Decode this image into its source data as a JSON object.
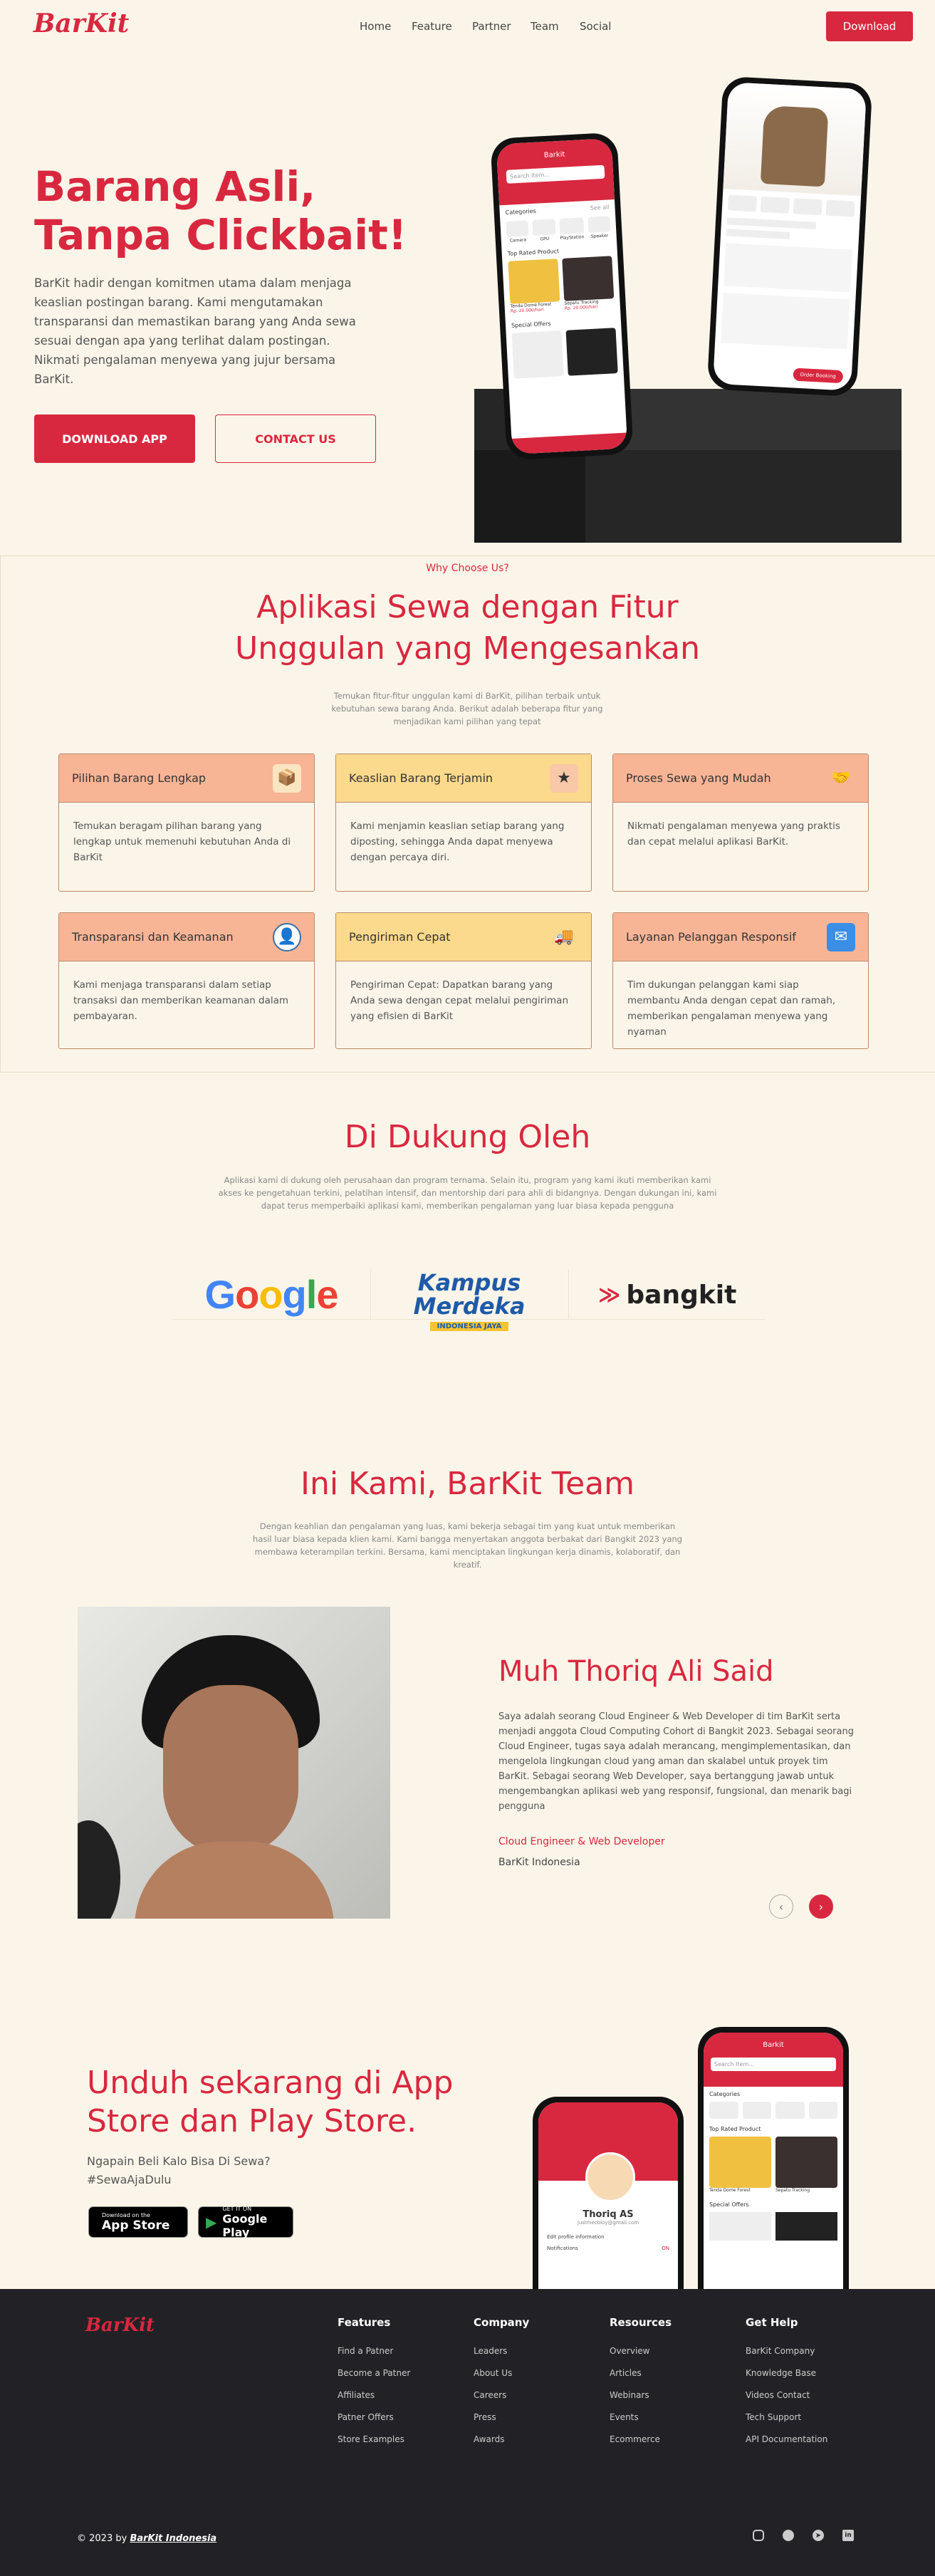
{
  "nav": {
    "logo": "BarKit",
    "links": [
      "Home",
      "Feature",
      "Partner",
      "Team",
      "Social"
    ],
    "download": "Download"
  },
  "hero": {
    "title_line1": "Barang Asli,",
    "title_line2": "Tanpa Clickbait!",
    "desc": "BarKit hadir dengan komitmen utama dalam menjaga keaslian postingan barang. Kami mengutamakan transparansi dan memastikan barang yang Anda sewa sesuai dengan apa yang terlihat dalam postingan. Nikmati pengalaman menyewa yang jujur bersama BarKit.",
    "download_app": "DOWNLOAD APP",
    "contact_us": "CONTACT US"
  },
  "phone_left": {
    "app_title": "Barkit",
    "search": "Search Item...",
    "categories": "Categories",
    "see_all": "See all",
    "cat_items": [
      "Camera",
      "GPU",
      "PlayStation",
      "Speaker"
    ],
    "top_rated": "Top Rated Product",
    "products": [
      {
        "name": "Tenda Dome Forest",
        "price": "Rp. 20.000/hari"
      },
      {
        "name": "Sepatu Tracking",
        "price": "Rp. 20.000/hari"
      }
    ],
    "special": "Special Offers"
  },
  "phone_right": {
    "order": "Order Booking"
  },
  "why": {
    "kicker": "Why Choose Us?",
    "title_line1": "Aplikasi Sewa dengan Fitur",
    "title_line2": "Unggulan yang Mengesankan",
    "desc": "Temukan fitur-fitur unggulan kami di BarKit, pilihan terbaik untuk kebutuhan sewa barang Anda. Berikut adalah beberapa fitur yang menjadikan kami pilihan yang tepat",
    "cards": [
      {
        "title": "Pilihan Barang Lengkap",
        "body": "Temukan beragam pilihan barang yang lengkap untuk memenuhi kebutuhan Anda di BarKit",
        "icon": "box-icon",
        "color": "#f8b596"
      },
      {
        "title": "Keaslian Barang Terjamin",
        "body": "Kami menjamin keaslian setiap barang yang diposting, sehingga Anda dapat menyewa dengan percaya diri.",
        "icon": "badge-icon",
        "color": "#fbd98d"
      },
      {
        "title": "Proses Sewa yang Mudah",
        "body": "Nikmati pengalaman menyewa yang praktis dan cepat melalui aplikasi BarKit.",
        "icon": "handshake-icon",
        "color": "#f8b596"
      },
      {
        "title": "Transparansi dan Keamanan",
        "body": "Kami menjaga transparansi dalam setiap transaksi dan memberikan keamanan dalam pembayaran.",
        "icon": "user-shield-icon",
        "color": "#f8b596"
      },
      {
        "title": "Pengiriman Cepat",
        "body": "Pengiriman Cepat: Dapatkan barang yang Anda sewa dengan cepat melalui pengiriman yang efisien di BarKit",
        "icon": "truck-icon",
        "color": "#fbd98d"
      },
      {
        "title": "Layanan Pelanggan Responsif",
        "body": "Tim dukungan pelanggan kami siap membantu Anda dengan cepat dan ramah, memberikan pengalaman menyewa yang nyaman",
        "icon": "support-icon",
        "color": "#f8b596"
      }
    ]
  },
  "support": {
    "title": "Di Dukung Oleh",
    "desc": "Aplikasi kami di dukung oleh perusahaan dan program ternama. Selain itu, program yang kami ikuti memberikan kami akses ke pengetahuan terkini, pelatihan intensif, dan mentorship dari para ahli di bidangnya. Dengan dukungan ini, kami dapat terus memperbaiki aplikasi kami, memberikan pengalaman yang luar biasa kepada pengguna",
    "google": "Google",
    "kampus1": "Kampus",
    "kampus2": "Merdeka",
    "kampus3": "INDONESIA JAYA",
    "bangkit": "bangkit"
  },
  "team": {
    "title": "Ini Kami, BarKit Team",
    "desc": "Dengan keahlian dan pengalaman yang luas, kami bekerja sebagai tim yang kuat untuk memberikan hasil luar biasa kepada klien kami. Kami bangga menyertakan anggota berbakat dari Bangkit 2023 yang membawa keterampilan terkini. Bersama, kami menciptakan lingkungan kerja dinamis, kolaboratif, dan kreatif.",
    "name": "Muh Thoriq Ali Said",
    "bio": "Saya adalah seorang Cloud Engineer & Web Developer di tim BarKit serta menjadi anggota Cloud Computing Cohort di Bangkit 2023. Sebagai seorang Cloud Engineer, tugas saya adalah merancang, mengimplementasikan, dan mengelola lingkungan cloud yang aman dan skalabel untuk proyek tim BarKit. Sebagai seorang Web Developer, saya bertanggung jawab untuk mengembangkan aplikasi web yang responsif, fungsional, dan menarik bagi pengguna",
    "role": "Cloud Engineer & Web Developer",
    "org": "BarKit Indonesia"
  },
  "cta": {
    "title_line1": "Unduh sekarang di App",
    "title_line2": "Store dan Play Store.",
    "sub1": "Ngapain Beli Kalo Bisa Di Sewa?",
    "sub2": "#SewaAjaDulu",
    "appstore_small": "Download on the",
    "appstore_big": "App Store",
    "play_small": "GET IT ON",
    "play_big": "Google Play",
    "profile_name": "Thoriq AS",
    "profile_email": "justmecbloy@gmail.com",
    "profile_menu": [
      "Edit profile information",
      "Notifications"
    ],
    "notif_on": "ON"
  },
  "footer": {
    "logo": "BarKit",
    "columns": [
      {
        "title": "Features",
        "links": [
          "Find a Patner",
          "Become a Patner",
          "Affiliates",
          "Patner Offers",
          "Store Examples"
        ]
      },
      {
        "title": "Company",
        "links": [
          "Leaders",
          "About Us",
          "Careers",
          "Press",
          "Awards"
        ]
      },
      {
        "title": "Resources",
        "links": [
          "Overview",
          "Articles",
          "Webinars",
          "Events",
          "Ecommerce"
        ]
      },
      {
        "title": "Get Help",
        "links": [
          "BarKit Company",
          "Knowledge Base",
          "Videos Contact",
          "Tech Support",
          "API Documentation"
        ]
      }
    ],
    "copyright": "© 2023 by",
    "copyright_link": "BarKit Indonesia",
    "social_icons": [
      "instagram-icon",
      "github-icon",
      "telegram-icon",
      "linkedin-icon"
    ]
  }
}
